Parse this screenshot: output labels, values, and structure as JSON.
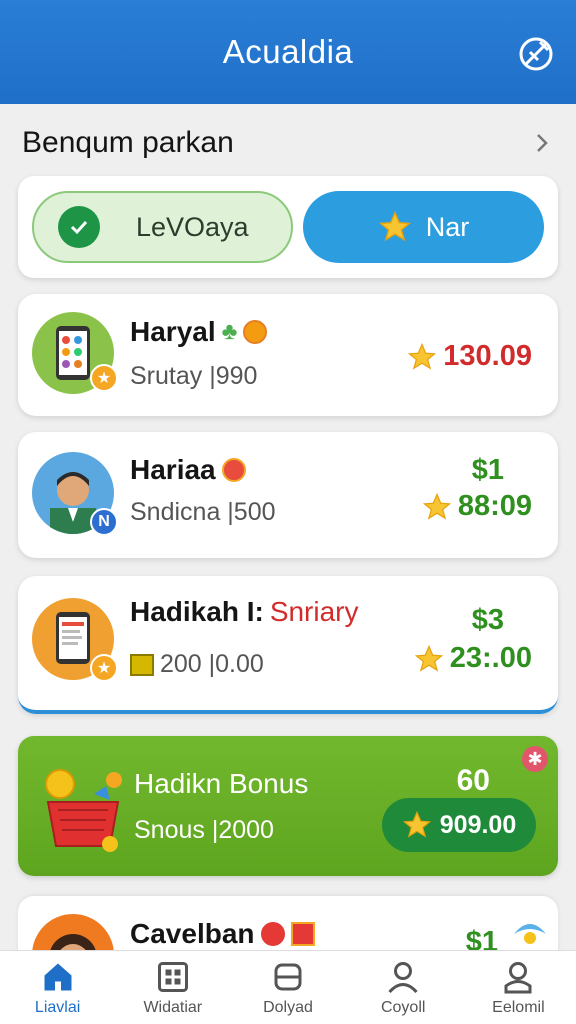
{
  "app": {
    "title": "Acualdia"
  },
  "section": {
    "title": "Benqum parkan"
  },
  "toggle": {
    "left_label": "LeVOaya",
    "right_label": "Nar"
  },
  "items": [
    {
      "name": "Haryal",
      "sub": "Srutay |990",
      "amount": "130.09",
      "amount_color": "#d22b2b",
      "icon": "phone-avatar-icon"
    },
    {
      "name": "Hariaa",
      "sub": "Sndicna |500",
      "amount_top": "$1",
      "amount": "88:09",
      "icon": "man-avatar-icon"
    },
    {
      "name_a": "Hadikah I:",
      "name_b": "Snriary",
      "sub": "200 |0.00",
      "amount_top": "$3",
      "amount": "23:.00",
      "icon": "tablet-avatar-icon"
    }
  ],
  "bonus": {
    "title": "Hadikn Bonus",
    "sub": "Snous |2000",
    "amount_top": "60",
    "amount": "909.00"
  },
  "partial_item": {
    "name": "Cavelban",
    "amount": "$1"
  },
  "nav": [
    {
      "label": "Liavlai",
      "icon": "home-icon"
    },
    {
      "label": "Widatiar",
      "icon": "grid-icon"
    },
    {
      "label": "Dolyad",
      "icon": "card-icon"
    },
    {
      "label": "Coyoll",
      "icon": "person-icon"
    },
    {
      "label": "Eelomil",
      "icon": "user-icon"
    }
  ],
  "colors": {
    "primary": "#1f6fc8",
    "green": "#2f8f1f",
    "red": "#d22b2b",
    "bonus": "#6cb12a"
  }
}
